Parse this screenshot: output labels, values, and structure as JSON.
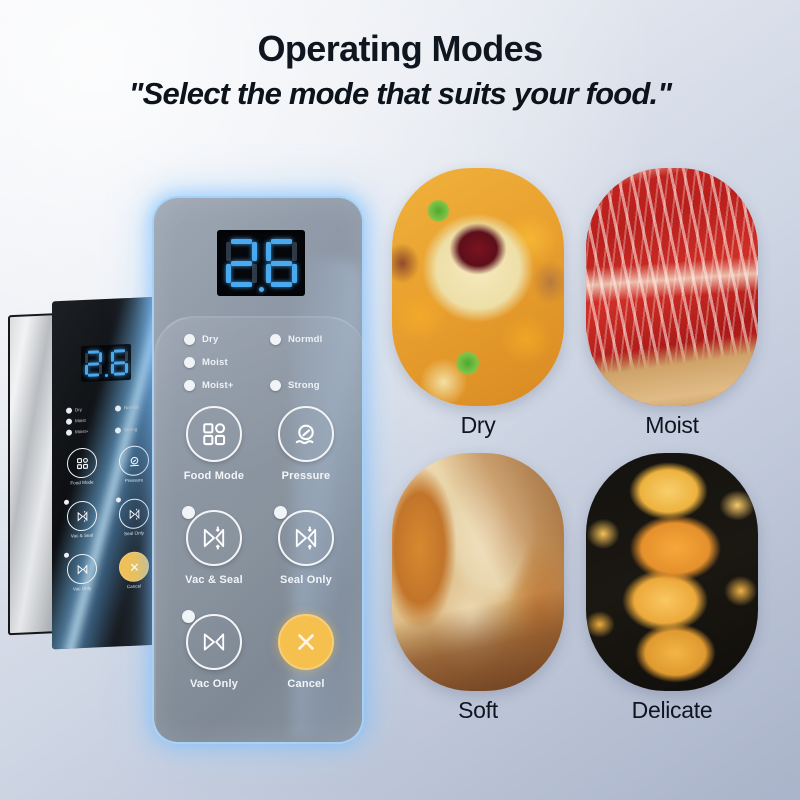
{
  "header": {
    "title": "Operating Modes",
    "subtitle": "\"Select the mode that suits your food.\""
  },
  "control_panel": {
    "display": {
      "value": "2.6",
      "digit_left": "2",
      "digit_right": "6",
      "decimal_point": true,
      "color": "#4aa9ef"
    },
    "indicators_left": [
      {
        "label": "Dry",
        "icon": "led-indicator-icon"
      },
      {
        "label": "Moist",
        "icon": "led-indicator-icon"
      },
      {
        "label": "Moist+",
        "icon": "led-indicator-icon"
      }
    ],
    "indicators_right": [
      {
        "label": "Normdl",
        "icon": "led-indicator-icon"
      },
      {
        "label": "Strong",
        "icon": "led-indicator-icon"
      }
    ],
    "buttons": [
      {
        "label": "Food Mode",
        "icon": "grid-squares-icon",
        "has_led": false,
        "filled": false
      },
      {
        "label": "Pressure",
        "icon": "pressure-gauge-icon",
        "has_led": false,
        "filled": false
      },
      {
        "label": "Vac & Seal",
        "icon": "vacuum-seal-icon",
        "has_led": true,
        "filled": false
      },
      {
        "label": "Seal Only",
        "icon": "seal-icon",
        "has_led": true,
        "filled": false
      },
      {
        "label": "Vac Only",
        "icon": "vacuum-icon",
        "has_led": true,
        "filled": false
      },
      {
        "label": "Cancel",
        "icon": "close-x-icon",
        "has_led": false,
        "filled": true
      }
    ],
    "accent_color": "#f5c04e",
    "panel_glow_color": "#8cc6ff"
  },
  "appliance": {
    "display_value": "2.6",
    "indicators_left": [
      "Dry",
      "Moist",
      "Moist+"
    ],
    "indicators_right": [
      "Normdl",
      "Strong"
    ],
    "buttons": [
      "Food Mode",
      "Pressure",
      "Vac & Seal",
      "Seal Only",
      "Vac Only",
      "Cancel"
    ]
  },
  "food_cards": [
    {
      "caption": "Dry",
      "photo": "dried-fruit-platter-photo"
    },
    {
      "caption": "Moist",
      "photo": "raw-marbled-beef-photo"
    },
    {
      "caption": "Soft",
      "photo": "sliced-bread-loaf-photo"
    },
    {
      "caption": "Delicate",
      "photo": "potato-chips-photo"
    }
  ],
  "colors": {
    "background_light": "#eff1f6",
    "background_dark": "#a9b3c9",
    "text": "#10161f",
    "accent_amber": "#f5c04e",
    "led_blue": "#4aa9ef"
  }
}
